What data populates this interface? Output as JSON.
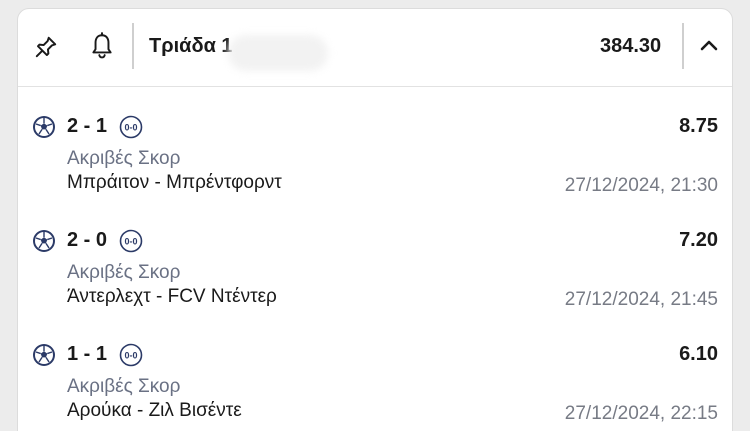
{
  "header": {
    "title": "Τριάδα 1",
    "total_odds": "384.30"
  },
  "selections": [
    {
      "score": "2 - 1",
      "halftime": "0-0",
      "odds": "8.75",
      "market": "Ακριβές Σκορ",
      "match": "Μπράιτον - Μπρέντφορντ",
      "datetime": "27/12/2024, 21:30"
    },
    {
      "score": "2 - 0",
      "halftime": "0-0",
      "odds": "7.20",
      "market": "Ακριβές Σκορ",
      "match": "Άντερλεχτ - FCV Ντέντερ",
      "datetime": "27/12/2024, 21:45"
    },
    {
      "score": "1 - 1",
      "halftime": "0-0",
      "odds": "6.10",
      "market": "Ακριβές Σκορ",
      "match": "Αρούκα - Ζιλ Βισέντε",
      "datetime": "27/12/2024, 22:15"
    }
  ],
  "icons": {
    "pin": "pin-icon",
    "bell": "bell-icon",
    "collapse": "chevron-up-icon",
    "sport": "soccer-ball-icon",
    "halftime": "halftime-score-icon"
  },
  "colors": {
    "icon_navy": "#2b3a67",
    "market_grey": "#6a7184",
    "date_grey": "#777b85"
  }
}
